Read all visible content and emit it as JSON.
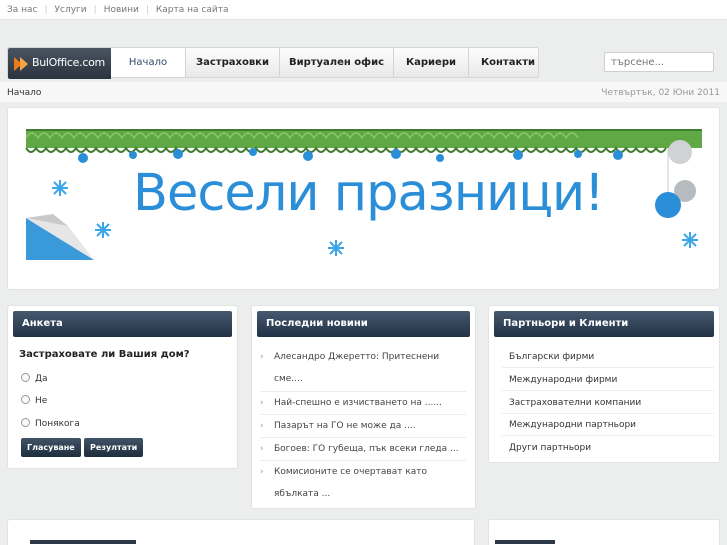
{
  "top_links": [
    "За нас",
    "Услуги",
    "Новини",
    "Карта на сайта"
  ],
  "logo": {
    "text": "BulOffice.com"
  },
  "nav": {
    "items": [
      {
        "label": "Начало",
        "active": true
      },
      {
        "label": "Застраховки",
        "active": false
      },
      {
        "label": "Виртуален офис",
        "active": false
      },
      {
        "label": "Кариери",
        "active": false
      },
      {
        "label": "Контакти",
        "active": false
      }
    ]
  },
  "search": {
    "placeholder": "търсене..."
  },
  "breadcrumb": "Начало",
  "date": "Четвъртък, 02 Юни 2011",
  "banner": {
    "text": "Весели празници!"
  },
  "poll": {
    "title": "Анкета",
    "question": "Застраховате ли Вашия дом?",
    "options": [
      "Да",
      "Не",
      "Понякога"
    ],
    "vote_label": "Гласуване",
    "results_label": "Резултати"
  },
  "news": {
    "title": "Последни новини",
    "items": [
      "Алесандро Джеретто: Притеснени сме....",
      "Най-спешно е изчистването на ......",
      "Пазарът на ГО не може да ....",
      "Богоев: ГО губеща, пък всеки гледа ...",
      "Комисионите се очертават като ябълката ..."
    ]
  },
  "partners": {
    "title": "Партньори и Клиенти",
    "items": [
      "Български фирми",
      "Международни фирми",
      "Застрахователни компании",
      "Международни партньори",
      "Други партньори"
    ]
  },
  "colors": {
    "header_dark": "#223146",
    "accent_blue": "#2a8ed8",
    "garland_green": "#4a9a3c"
  }
}
